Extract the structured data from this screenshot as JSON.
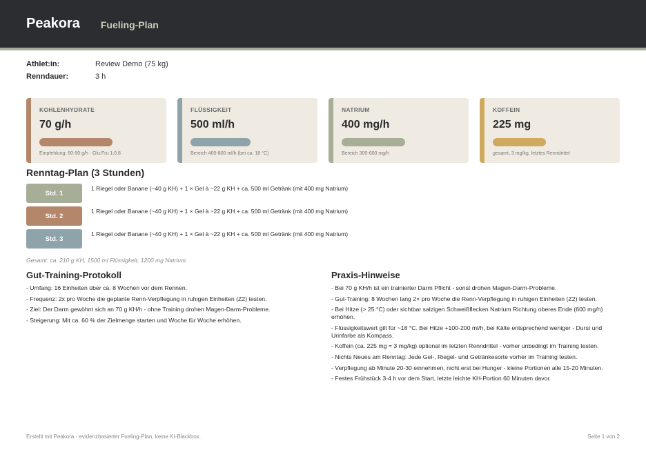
{
  "header": {
    "brand": "Peakora",
    "doc_title": "Fueling-Plan"
  },
  "meta": [
    {
      "key": "Athlet:in:",
      "value": "Review Demo (75 kg)"
    },
    {
      "key": "Renndauer:",
      "value": "3 h"
    }
  ],
  "cards": [
    {
      "label": "KOHLENHYDRATE",
      "value": "70 g/h",
      "note": "Empfehlung: 60-90 g/h · Glu:Fru 1:0.8",
      "color": "#b5876a",
      "bar_fill": 0.63
    },
    {
      "label": "FLÜSSIGKEIT",
      "value": "500 ml/h",
      "note": "Bereich 400-800 ml/h (bei ca. 18 °C)",
      "color": "#8fa3ab",
      "bar_fill": 0.52
    },
    {
      "label": "NATRIUM",
      "value": "400 mg/h",
      "note": "Bereich 300-600 mg/h",
      "color": "#a6ae98",
      "bar_fill": 0.55
    },
    {
      "label": "KOFFEIN",
      "value": "225 mg",
      "note": "gesamt, 3 mg/kg, letztes Renndrittel",
      "color": "#cfaa5e",
      "bar_fill": 0.46
    }
  ],
  "plan": {
    "title": "Renntag-Plan (3 Stunden)",
    "rows": [
      {
        "badge": "Std. 1",
        "text": "1 Riegel oder Banane (~40 g KH) + 1 × Gel à ~22 g KH + ca. 500 ml Getränk (mit 400 mg Natrium)",
        "color": "#a6ae98"
      },
      {
        "badge": "Std. 2",
        "text": "1 Riegel oder Banane (~40 g KH) + 1 × Gel à ~22 g KH + ca. 500 ml Getränk (mit 400 mg Natrium)",
        "color": "#b5876a"
      },
      {
        "badge": "Std. 3",
        "text": "1 Riegel oder Banane (~40 g KH) + 1 × Gel à ~22 g KH + ca. 500 ml Getränk (mit 400 mg Natrium)",
        "color": "#8fa3ab"
      }
    ],
    "summary": "Gesamt: ca. 210 g KH, 1500 ml Flüssigkeit, 1200 mg Natrium."
  },
  "gut_training": {
    "title": "Gut-Training-Protokoll",
    "items": [
      "- Umfang: 16 Einheiten über ca. 8 Wochen vor dem Rennen.",
      "- Frequenz: 2x pro Woche die geplante Renn-Verpflegung in ruhigen Einheiten (Z2) testen.",
      "- Ziel: Der Darm gewöhnt sich an 70 g KH/h - ohne Training drohen Magen-Darm-Probleme.",
      "- Steigerung: Mit ca. 60 % der Zielmenge starten und Woche für Woche erhöhen."
    ]
  },
  "praxis": {
    "title": "Praxis-Hinweise",
    "items": [
      "- Bei 70 g KH/h ist ein trainierter Darm Pflicht - sonst drohen Magen-Darm-Probleme.",
      "- Gut-Training: 8 Wochen lang 2× pro Woche die Renn-Verpflegung in ruhigen Einheiten (Z2) testen.",
      "- Bei Hitze (> 25 °C) oder sichtbar salzigen Schweißflecken Natrium Richtung oberes Ende (600 mg/h) erhöhen.",
      "- Flüssigkeitswert gilt für ~18 °C. Bei Hitze +100-200 ml/h, bei Kälte entsprechend weniger - Durst und Urinfarbe als Kompass.",
      "- Koffein (ca. 225 mg = 3 mg/kg) optional im letzten Renndrittel - vorher unbedingt im Training testen.",
      "- Nichts Neues am Renntag: Jede Gel-, Riegel- und Getränkesorte vorher im Training testen.",
      "- Verpflegung ab Minute 20-30 einnehmen, nicht erst bei Hunger - kleine Portionen alle 15-20 Minuten.",
      "- Festes Frühstück 3-4 h vor dem Start, letzte leichte KH-Portion 60 Minuten davor."
    ]
  },
  "footer": {
    "left": "Erstellt mit Peakora - evidenzbasierter Fueling-Plan, keine KI-Blackbox.",
    "right": "Seite 1 von 2"
  }
}
